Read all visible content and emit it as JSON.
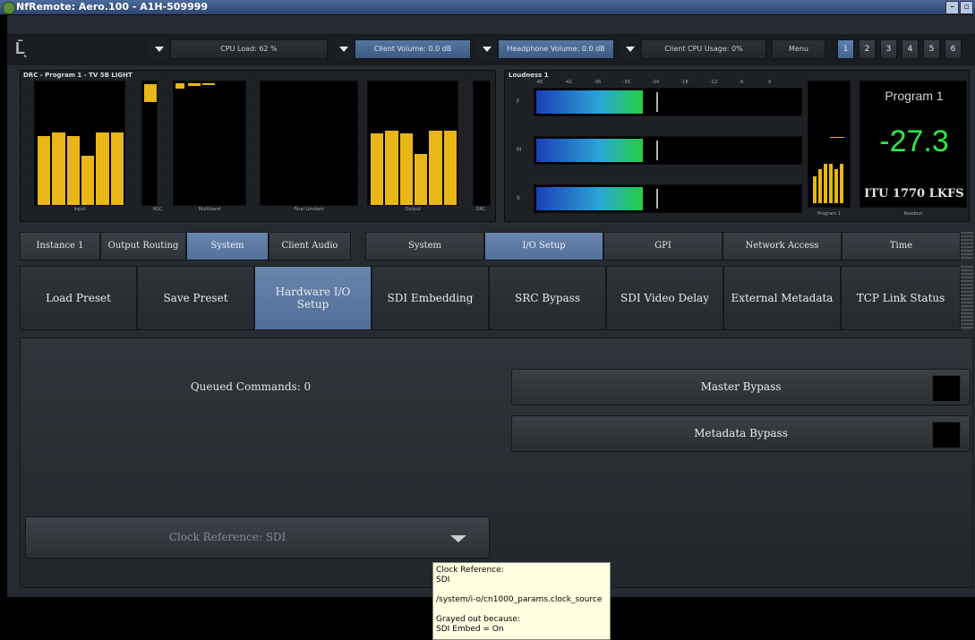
{
  "window": {
    "title": "NfRemote: Aero.100 - A1H-509999"
  },
  "toolbar": {
    "cpu_load": "CPU Load: 62 %",
    "client_volume": "Client Volume: 0.0 dB",
    "headphone_volume": "Headphone Volume: 0.0 dB",
    "client_cpu": "Client CPU Usage: 0%",
    "menu": "Menu",
    "pages": [
      "1",
      "2",
      "3",
      "4",
      "5",
      "6"
    ]
  },
  "drc_panel": {
    "title": "DRC - Program 1 - TV 5B LIGHT",
    "labels": [
      "Input",
      "AGC",
      "Multiband",
      "Final Limiters",
      "Output",
      "DRC"
    ],
    "input_levels": [
      0.56,
      0.59,
      0.56,
      0.4,
      0.59,
      0.59
    ],
    "output_levels": [
      0.58,
      0.6,
      0.58,
      0.41,
      0.6,
      0.6
    ]
  },
  "loudness_panel": {
    "title": "Loudness 1",
    "scale": [
      "-48",
      "-42",
      "-36",
      "-30",
      "-24",
      "-18",
      "-12",
      "-6",
      "0"
    ],
    "rows": [
      {
        "label": "F",
        "fill": 0.4
      },
      {
        "label": "M",
        "fill": 0.4
      },
      {
        "label": "S",
        "fill": 0.4
      }
    ],
    "program_label": "Program 1",
    "readout_label": "Readout"
  },
  "readout": {
    "program": "Program 1",
    "value": "-27.3",
    "unit": "ITU 1770 LKFS",
    "color": "#2ee84a"
  },
  "tabs_left": [
    "Instance 1",
    "Output Routing",
    "System",
    "Client Audio"
  ],
  "tabs_right": [
    "System",
    "I/O Setup",
    "GPI",
    "Network Access",
    "Time"
  ],
  "tiles": [
    "Load Preset",
    "Save Preset",
    "Hardware I/O Setup",
    "SDI Embedding",
    "SRC Bypass",
    "SDI Video Delay",
    "External Metadata",
    "TCP Link Status"
  ],
  "main": {
    "queued": "Queued Commands: 0",
    "master_bypass": "Master Bypass",
    "metadata_bypass": "Metadata Bypass",
    "clock_ref": "Clock Reference: SDI"
  },
  "tooltip": {
    "line1": "Clock Reference:",
    "line2": "SDI",
    "line3": "/system/i-o/cn1000_params.clock_source",
    "line4": "Grayed out because:",
    "line5": "SDI Embed = On"
  },
  "colors": {
    "accent": "#5e7fae",
    "meter_yellow": "#e9b617"
  }
}
